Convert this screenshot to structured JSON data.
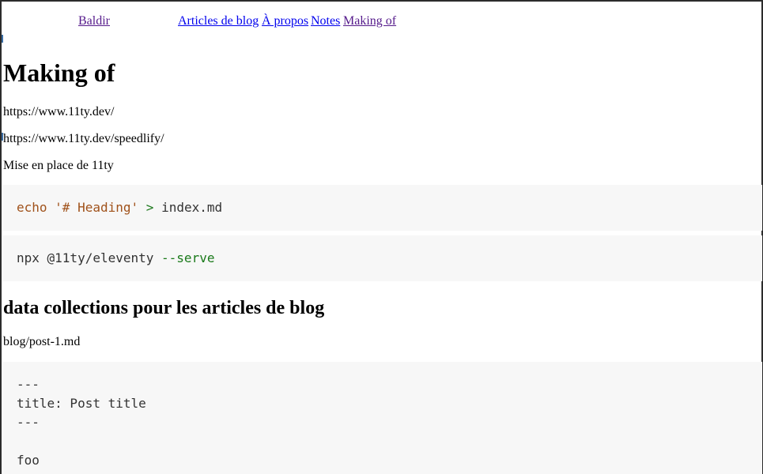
{
  "nav": {
    "site_title": "Baldir",
    "links": [
      "Articles de blog",
      "À propos",
      "Notes",
      "Making of"
    ]
  },
  "page_title": "Making of",
  "links": [
    "https://www.11ty.dev/",
    "https://www.11ty.dev/speedlify/"
  ],
  "intro": "Mise en place de 11ty",
  "code_blocks": {
    "heading_cmd": {
      "cmd": "echo",
      "str": "'# Heading'",
      "op": ">",
      "target": "index.md"
    },
    "serve_cmd": {
      "cmd": "npx @11ty/eleventy",
      "flag": "--serve"
    },
    "post_file": {
      "lines": [
        "---",
        "title: Post title",
        "---",
        "",
        "foo"
      ]
    }
  },
  "section": {
    "heading": "data collections pour les articles de blog",
    "file_label": "blog/post-1.md"
  },
  "colors": {
    "link": "#0000ee",
    "visited_link": "#551a8b",
    "code_bg": "#f7f7f7",
    "code_keyword": "#a0521b",
    "code_operator": "#1f7a1f"
  }
}
